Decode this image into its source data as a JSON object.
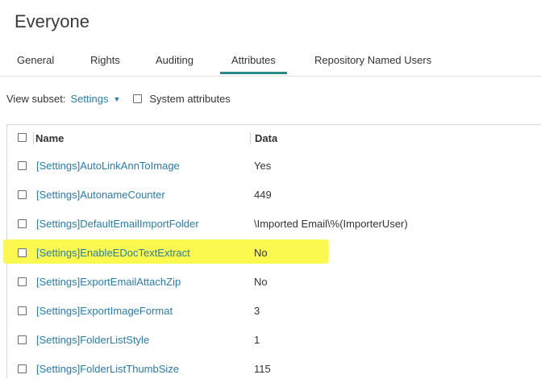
{
  "page": {
    "title": "Everyone"
  },
  "tabs": [
    {
      "label": "General",
      "active": false
    },
    {
      "label": "Rights",
      "active": false
    },
    {
      "label": "Auditing",
      "active": false
    },
    {
      "label": "Attributes",
      "active": true
    },
    {
      "label": "Repository Named Users",
      "active": false
    }
  ],
  "subset": {
    "label": "View subset:",
    "value": "Settings",
    "system_attributes_label": "System attributes"
  },
  "grid": {
    "columns": {
      "name": "Name",
      "data": "Data"
    },
    "rows": [
      {
        "name": "[Settings]AutoLinkAnnToImage",
        "data": "Yes"
      },
      {
        "name": "[Settings]AutonameCounter",
        "data": "449"
      },
      {
        "name": "[Settings]DefaultEmailImportFolder",
        "data": "\\Imported Email\\%(ImporterUser)"
      },
      {
        "name": "[Settings]EnableEDocTextExtract",
        "data": "No",
        "highlighted": true
      },
      {
        "name": "[Settings]ExportEmailAttachZip",
        "data": "No"
      },
      {
        "name": "[Settings]ExportImageFormat",
        "data": "3"
      },
      {
        "name": "[Settings]FolderListStyle",
        "data": "1"
      },
      {
        "name": "[Settings]FolderListThumbSize",
        "data": "115"
      }
    ]
  },
  "colors": {
    "accent": "#2a8c8c",
    "link": "#2a7ca8",
    "highlight": "#fbf94f"
  }
}
